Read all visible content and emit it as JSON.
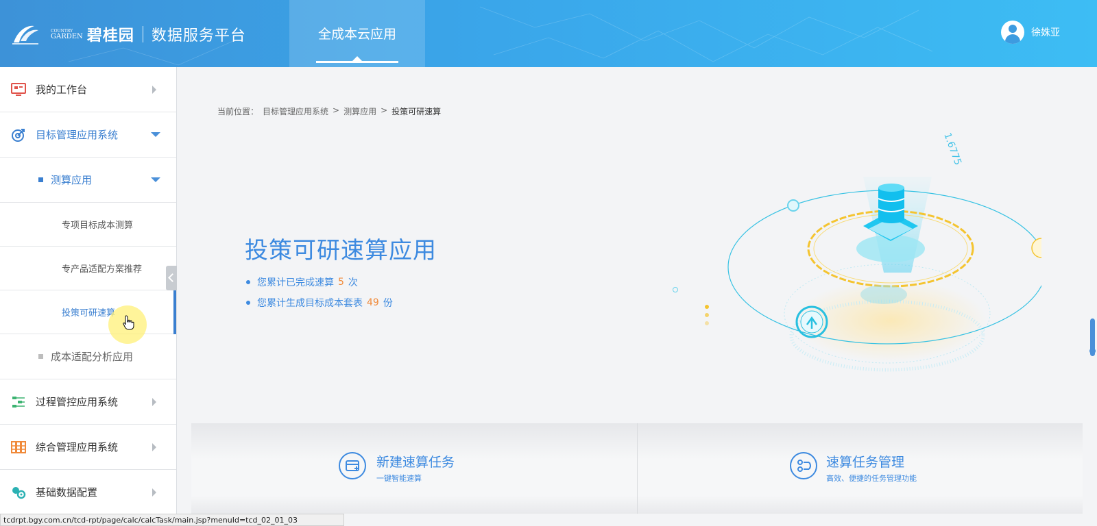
{
  "header": {
    "logo_en": [
      "COUNTRY",
      "GARDEN"
    ],
    "logo_cn": "碧桂园",
    "platform_title": "数据服务平台",
    "active_tab": "全成本云应用",
    "user_name": "徐姝亚"
  },
  "sidebar": {
    "items": [
      {
        "label": "我的工作台",
        "icon": "workbench-icon",
        "state": "collapsed"
      },
      {
        "label": "目标管理应用系统",
        "icon": "target-icon",
        "state": "expanded"
      },
      {
        "label": "测算应用",
        "state": "expanded"
      },
      {
        "label": "专项目标成本测算"
      },
      {
        "label": "专产品适配方案推荐"
      },
      {
        "label": "投策可研速算",
        "state": "active"
      },
      {
        "label": "成本适配分析应用",
        "state": "collapsed"
      },
      {
        "label": "过程管控应用系统",
        "icon": "process-icon",
        "state": "collapsed"
      },
      {
        "label": "综合管理应用系统",
        "icon": "grid-icon",
        "state": "collapsed"
      },
      {
        "label": "基础数据配置",
        "icon": "config-icon",
        "state": "collapsed"
      }
    ]
  },
  "breadcrumb": {
    "prefix": "当前位置：",
    "items": [
      "目标管理应用系统",
      "测算应用",
      "投策可研速算"
    ],
    "separator": ">"
  },
  "hero": {
    "title": "投策可研速算应用",
    "stat1_prefix": "您累计已完成速算",
    "stat1_value": "5",
    "stat1_suffix": "次",
    "stat2_prefix": "您累计生成目标成本套表",
    "stat2_value": "49",
    "stat2_suffix": "份",
    "illustration_label": "1.6775"
  },
  "cards": [
    {
      "title": "新建速算任务",
      "subtitle": "一键智能速算",
      "icon": "new-task-icon"
    },
    {
      "title": "速算任务管理",
      "subtitle": "高效、便捷的任务管理功能",
      "icon": "task-manage-icon"
    }
  ],
  "status_bar": {
    "url": "tcdrpt.bgy.com.cn/tcd-rpt/page/calc/calcTask/main.jsp?menuId=tcd_02_01_03"
  },
  "colors": {
    "header_gradient_start": "#3d92d8",
    "header_gradient_end": "#3dbdf4",
    "accent": "#3d8ae0",
    "highlight_number": "#f08a3a"
  }
}
